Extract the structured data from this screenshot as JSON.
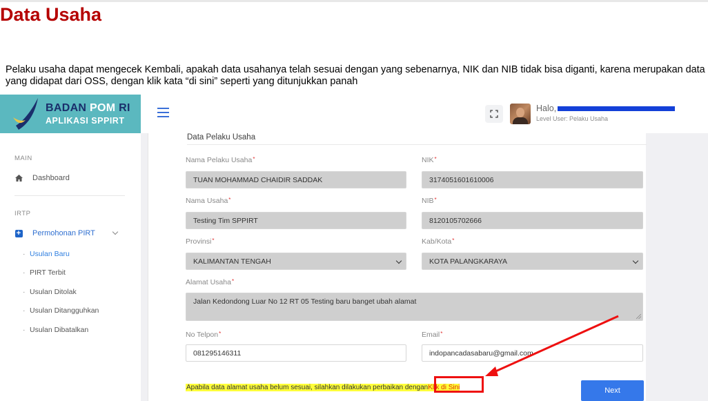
{
  "doc": {
    "title": "Data Usaha",
    "paragraph": "Pelaku usaha dapat mengecek Kembali, apakah data usahanya telah sesuai dengan yang sebenarnya, NIK dan NIB tidak bisa diganti, karena merupakan data yang didapat dari OSS, dengan klik kata “di sini” seperti yang ditunjukkan panah"
  },
  "brand": {
    "line1_a": "BADAN ",
    "line1_b": "POM",
    "line1_c": " RI",
    "line2": "APLIKASI SPPIRT"
  },
  "header": {
    "hello": "Halo,",
    "level": "Level User: Pelaku Usaha"
  },
  "sidebar": {
    "main_label": "MAIN",
    "dashboard": "Dashboard",
    "irtp_label": "IRTP",
    "permohonan": "Permohonan PIRT",
    "sub_items": [
      "Usulan Baru",
      "PIRT Terbit",
      "Usulan Ditolak",
      "Usulan Ditangguhkan",
      "Usulan Dibatalkan"
    ]
  },
  "form": {
    "section_title": "Data Pelaku Usaha",
    "req_mark": "*",
    "nama_pelaku": {
      "label": "Nama Pelaku Usaha",
      "value": "TUAN MOHAMMAD CHAIDIR SADDAK"
    },
    "nik": {
      "label": "NIK",
      "value": "3174051601610006"
    },
    "nama_usaha": {
      "label": "Nama Usaha",
      "value": "Testing Tim SPPIRT"
    },
    "nib": {
      "label": "NIB",
      "value": "8120105702666"
    },
    "provinsi": {
      "label": "Provinsi",
      "value": "KALIMANTAN TENGAH"
    },
    "kabkota": {
      "label": "Kab/Kota",
      "value": "KOTA PALANGKARAYA"
    },
    "alamat": {
      "label": "Alamat Usaha",
      "value": "Jalan Kedondong Luar No 12 RT 05 Testing baru banget ubah alamat"
    },
    "telpon": {
      "label": "No Telpon",
      "value": "081295146311"
    },
    "email": {
      "label": "Email",
      "value": "indopancadasabaru@gmail.com"
    },
    "notice_text": "Apabila data alamat usaha belum sesuai, silahkan dilakukan perbaikan dengan ",
    "notice_link": "Klik di Sini",
    "next": "Next"
  },
  "colors": {
    "title_red": "#b50000",
    "logo_teal": "#5bb8bf",
    "primary_blue": "#3578ea",
    "highlight_yellow": "#ffff3a",
    "annotation_red": "#ee1010"
  },
  "icons": [
    "home-icon",
    "plus-square-icon",
    "chevron-down-icon",
    "hamburger-icon",
    "fullscreen-icon"
  ]
}
